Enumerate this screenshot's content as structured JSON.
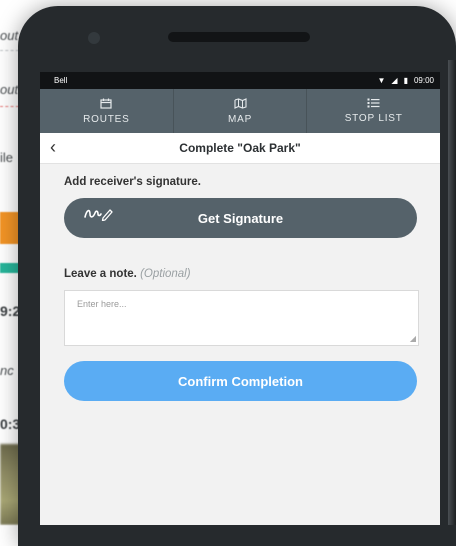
{
  "background": {
    "fragments": [
      "out",
      "out",
      "ile",
      "9:2",
      "nc",
      "0:3"
    ]
  },
  "status_bar": {
    "carrier": "Bell",
    "time": "09:00"
  },
  "nav": {
    "tabs": [
      {
        "label": "ROUTES",
        "icon": "calendar-icon"
      },
      {
        "label": "MAP",
        "icon": "map-icon"
      },
      {
        "label": "STOP LIST",
        "icon": "list-icon"
      }
    ]
  },
  "header": {
    "title": "Complete \"Oak Park\""
  },
  "form": {
    "signature_label": "Add receiver's signature.",
    "signature_button": "Get Signature",
    "note_label": "Leave a note.",
    "note_optional": "(Optional)",
    "note_placeholder": "Enter here...",
    "confirm_button": "Confirm Completion"
  },
  "colors": {
    "nav_bg": "#55626a",
    "primary_button": "#5aacf3",
    "accent_orange": "#f29426",
    "accent_teal": "#27b59a"
  }
}
